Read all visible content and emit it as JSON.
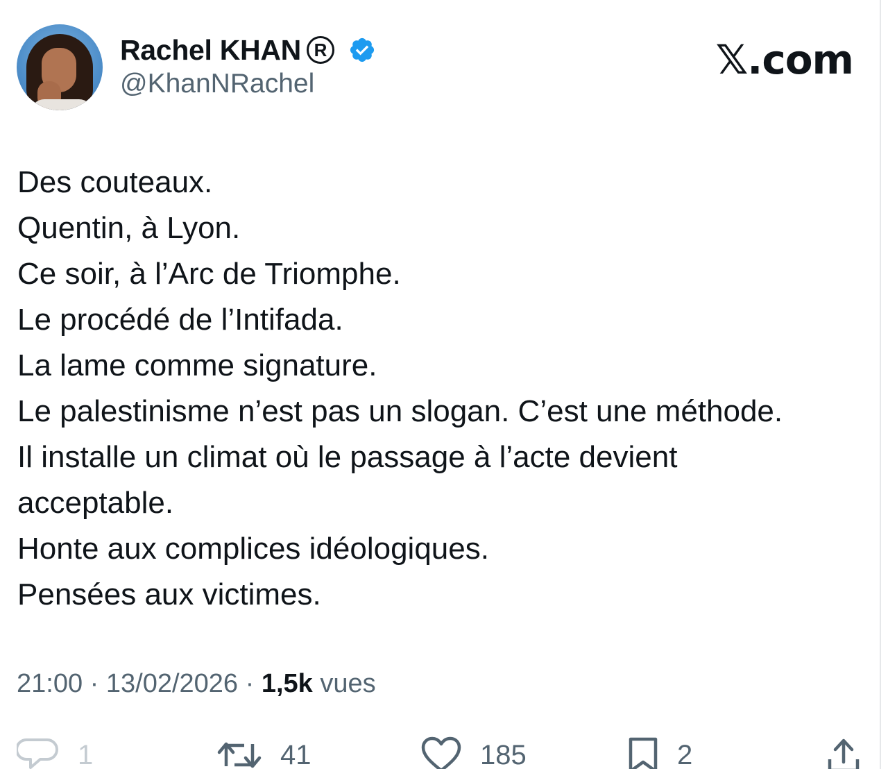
{
  "author": {
    "display_name": "Rachel KHAN",
    "registered_mark": "R",
    "handle": "@KhanNRachel",
    "verified": true,
    "verified_color": "#1d9bf0"
  },
  "brand": "𝕏.com",
  "tweet": {
    "lines": [
      "Des couteaux.",
      "Quentin, à Lyon.",
      "Ce soir, à l’Arc de Triomphe.",
      "Le procédé de l’Intifada.",
      "La lame comme signature.",
      "Le palestinisme n’est pas un slogan. C’est une méthode.",
      "Il installe un climat où le passage à l’acte devient",
      "acceptable.",
      "Honte aux complices idéologiques.",
      "Pensées aux victimes."
    ]
  },
  "meta": {
    "time": "21:00",
    "separator": " · ",
    "date": "13/02/2026",
    "views_count": "1,5k",
    "views_label": " vues"
  },
  "actions": {
    "replies": "1",
    "reposts": "41",
    "likes": "185",
    "bookmarks": "2"
  },
  "colors": {
    "text_primary": "#0f1419",
    "text_secondary": "#536471",
    "background": "#ffffff"
  }
}
